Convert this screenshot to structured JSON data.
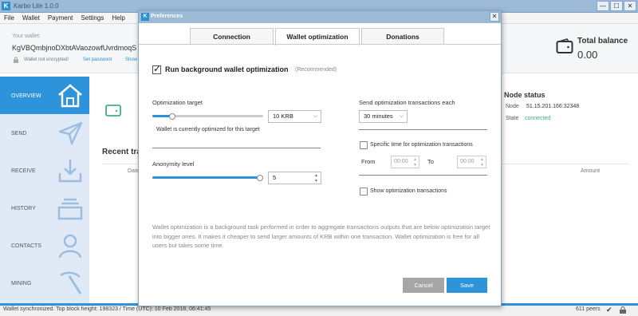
{
  "window": {
    "title": "Karbo Lite 1.0.0",
    "logo_letter": "K",
    "min": "—",
    "max": "☐",
    "close": "✕"
  },
  "menu": [
    "File",
    "Wallet",
    "Payment",
    "Settings",
    "Help"
  ],
  "header": {
    "wallet_label": "Your wallet:",
    "wallet_address": "KgVBQmbjnoDXbtAVaozowfUvrdmoqS",
    "encryption_status": "Wallet not encrypted!",
    "set_password": "Set password",
    "show": "Show",
    "balance_label": "Total balance",
    "balance_value": "0.00"
  },
  "sidebar": {
    "items": [
      {
        "label": "OVERVIEW",
        "icon": "home-icon"
      },
      {
        "label": "SEND",
        "icon": "send-icon"
      },
      {
        "label": "RECEIVE",
        "icon": "receive-icon"
      },
      {
        "label": "HISTORY",
        "icon": "history-icon"
      },
      {
        "label": "CONTACTS",
        "icon": "contacts-icon"
      },
      {
        "label": "MINING",
        "icon": "pickaxe-icon"
      }
    ]
  },
  "main": {
    "recent_title": "Recent tra",
    "col_date": "Date",
    "col_amount": "Amount",
    "node_title": "Node status",
    "node_key": "Node",
    "node_value": "51.15.201.166:32348",
    "state_key": "State",
    "state_value": "connected"
  },
  "status": {
    "text": "Wallet synchronized. Top block height: 198323  /  Time (UTC): 10 Feb 2018, 06:41:45",
    "peers": "611 peers",
    "check": "✔"
  },
  "dialog": {
    "title": "Preferences",
    "logo_letter": "K",
    "close": "✕",
    "tabs": [
      "Connection",
      "Wallet optimization",
      "Donations"
    ],
    "run_label": "Run background wallet optimization",
    "run_checked": true,
    "check_mark": "✓",
    "recommended": "(Recommended)",
    "opt_target_label": "Optimization target",
    "opt_target_value": "10 KRB",
    "opt_status": "Wallet is currently optimized for this target",
    "anon_label": "Anonymity level",
    "anon_value": "5",
    "send_each_label": "Send optimization transactions each",
    "send_each_value": "30 minutes",
    "specific_label": "Specific time for optimization transactions",
    "from_label": "From",
    "from_value": "00:00",
    "to_label": "To",
    "to_value": "00:00",
    "show_label": "Show optimization transactions",
    "description": "Wallet optimization is a background task performed in order to aggregate transactions outputs that are below optimization target into bigger ones. It makes it cheaper to send larger amounts of KRB within one transaction. Wallet optimization is free for all users but takes some time.",
    "cancel": "Cancel",
    "save": "Save",
    "combo_arrow": "⌵",
    "spin_up": "▲",
    "spin_down": "▼"
  },
  "colors": {
    "accent": "#2d93db",
    "sidebar": "#dfeaf6",
    "titlebar": "#9cb9d6",
    "connected": "#3fb17a"
  }
}
